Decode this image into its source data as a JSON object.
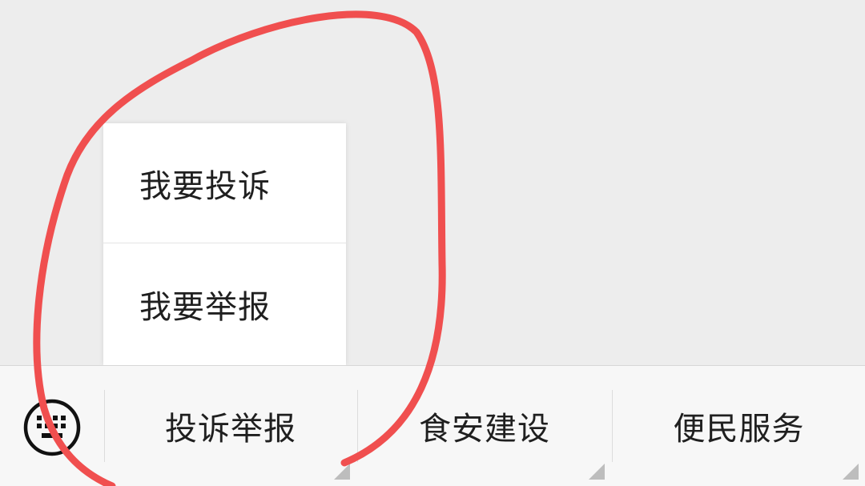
{
  "popup_menu": {
    "items": [
      {
        "label": "我要投诉"
      },
      {
        "label": "我要举报"
      }
    ]
  },
  "bottom_bar": {
    "keyboard_icon": "keyboard-icon",
    "tabs": [
      {
        "label": "投诉举报"
      },
      {
        "label": "食安建设"
      },
      {
        "label": "便民服务"
      }
    ]
  },
  "colors": {
    "annotation": "#f04f4f",
    "background": "#ededed",
    "bar": "#f7f7f7"
  }
}
